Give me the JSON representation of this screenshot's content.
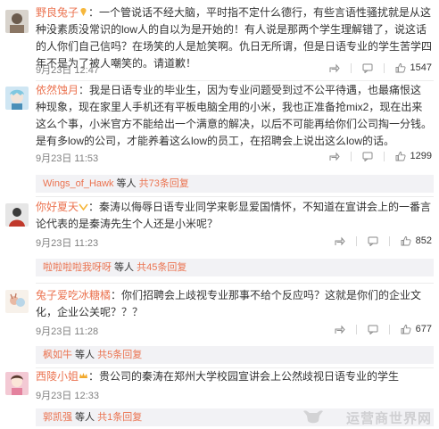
{
  "comments": [
    {
      "user": "野良兔子",
      "text": "：一个管说话不经大脑，平时指不定什么德行，有些言语性骚扰就是从这种没素质没常识的low人的自以为是开始的！有人说是那两个学生理解错了，说这话的人你们自己信吗？在场笑的人是尬笑啊。仇日无所谓，但是日语专业的学生苦学四年不是为了被人嘲笑的。请道歉！",
      "time": "9月23日 12:47",
      "likes": "1547"
    },
    {
      "user": "依然蚀月",
      "text": "：我是日语专业的毕业生，因为专业问题受到过不公平待遇，也最痛恨这种现象，现在家里人手机还有平板电脑全用的小米，我也正准备抢mix2，现在出来这么个事，小米官方不能给出一个满意的解决，以后不可能再给你们公司掏一分钱。是有多low的公司，才能养着这么low的员工，在招聘会上说出这么low的话。",
      "time": "9月23日 11:53",
      "likes": "1299",
      "reply": {
        "name": "Wings_of_Hawk",
        "suffix": " 等人 ",
        "count": "共73条回复"
      }
    },
    {
      "user": "你好夏天",
      "text": "：秦涛以侮辱日语专业同学来彰显爱国情怀，不知道在宣讲会上的一番言论代表的是秦涛先生个人还是小米呢？",
      "time": "9月23日 11:23",
      "likes": "852",
      "reply": {
        "name": "啦啦啦啦我呀呀",
        "suffix": " 等人 ",
        "count": "共45条回复"
      }
    },
    {
      "user": "兔子爱吃冰糖橘",
      "text": "：你们招聘会上歧视专业那事不给个反应吗？这就是你们的企业文化，企业公关呢？？？",
      "time": "9月23日 11:28",
      "likes": "677",
      "reply": {
        "name": "枫如牛",
        "suffix": " 等人 ",
        "count": "共5条回复"
      }
    },
    {
      "user": "西陵小姐",
      "text": "：贵公司的秦涛在郑州大学校园宣讲会上公然歧视日语专业的学生",
      "time": "9月23日 12:33",
      "reply": {
        "name": "郭凯强",
        "suffix": " 等人 ",
        "count": "共1条回复"
      }
    }
  ],
  "watermark": "运营商世界网"
}
